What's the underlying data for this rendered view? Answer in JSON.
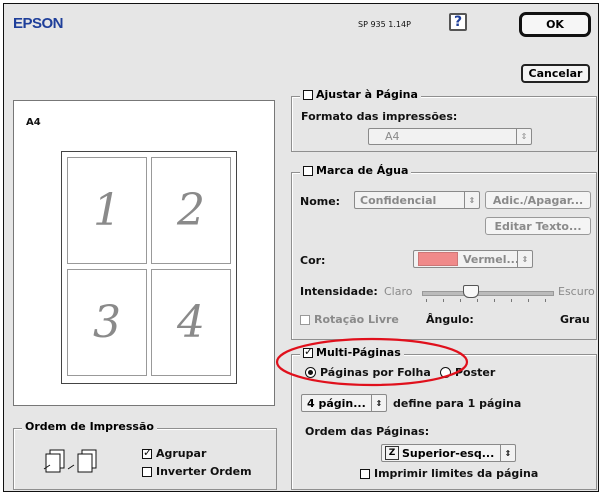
{
  "header": {
    "brand": "EPSON",
    "model": "SP 935 1.14P",
    "help_label": "?",
    "ok_label": "OK",
    "cancel_label": "Cancelar"
  },
  "preview": {
    "paper_label": "A4",
    "page_numbers": [
      "1",
      "2",
      "3",
      "4"
    ]
  },
  "print_order": {
    "title": "Ordem de Impressão",
    "collate_label": "Agrupar",
    "collate_checked": true,
    "reverse_label": "Inverter Ordem",
    "reverse_checked": false
  },
  "fit_to_page": {
    "label": "Ajustar à Página",
    "checked": false,
    "output_paper_label": "Formato das impressões:",
    "output_paper_value": "A4"
  },
  "watermark": {
    "label": "Marca de Água",
    "checked": false,
    "name_label": "Nome:",
    "name_value": "Confidencial",
    "add_delete_label": "Adic./Apagar...",
    "edit_text_label": "Editar Texto...",
    "color_label": "Cor:",
    "color_value": "Vermel...",
    "color_swatch": "#f08a8a",
    "intensity_label": "Intensidade:",
    "intensity_low": "Claro",
    "intensity_high": "Escuro",
    "intensity_level": 0.35,
    "rotate_label": "Rotação Livre",
    "angle_label": "Ângulo:",
    "angle_unit": "Grau"
  },
  "multi_page": {
    "label": "Multi-Páginas",
    "checked": true,
    "pages_per_sheet_label": "Páginas por Folha",
    "pages_per_sheet_selected": true,
    "poster_label": "Poster",
    "pages_value": "4 págin...",
    "pages_suffix": "define para 1 página",
    "page_order_label": "Ordem das Páginas:",
    "page_order_value": "Superior-esq...",
    "print_borders_label": "Imprimir limites da página",
    "print_borders_checked": false
  },
  "colors": {
    "highlight_ellipse": "#e0101c",
    "brand_blue": "#1f3f9a"
  }
}
